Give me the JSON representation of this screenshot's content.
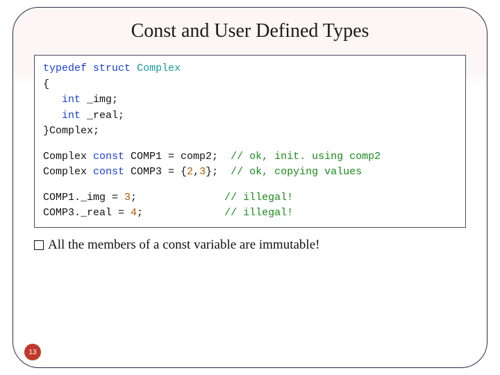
{
  "title": "Const and User Defined Types",
  "code": {
    "typedef_l1_kw1": "typedef",
    "typedef_l1_kw2": "struct",
    "typedef_l1_ty": "Complex",
    "typedef_l2": "{",
    "typedef_l3_kw": "int",
    "typedef_l3_rest": " _img;",
    "typedef_l4_kw": "int",
    "typedef_l4_rest": " _real;",
    "typedef_l5": "}Complex;",
    "decl_l1_a": "Complex ",
    "decl_l1_kw": "const",
    "decl_l1_b": " COMP1 = comp2;  ",
    "decl_l1_cm": "// ok, init. using comp2",
    "decl_l2_a": "Complex ",
    "decl_l2_kw": "const",
    "decl_l2_b": " COMP3 = {",
    "decl_l2_n1": "2",
    "decl_l2_c": ",",
    "decl_l2_n2": "3",
    "decl_l2_d": "};  ",
    "decl_l2_cm": "// ok, copying values",
    "asn_l1_a": "COMP1._img = ",
    "asn_l1_n": "3",
    "asn_l1_b": ";              ",
    "asn_l1_cm": "// illegal!",
    "asn_l2_a": "COMP3._real = ",
    "asn_l2_n": "4",
    "asn_l2_b": ";             ",
    "asn_l2_cm": "// illegal!"
  },
  "caption": "All the members of a const variable are immutable!",
  "page_number": "13"
}
